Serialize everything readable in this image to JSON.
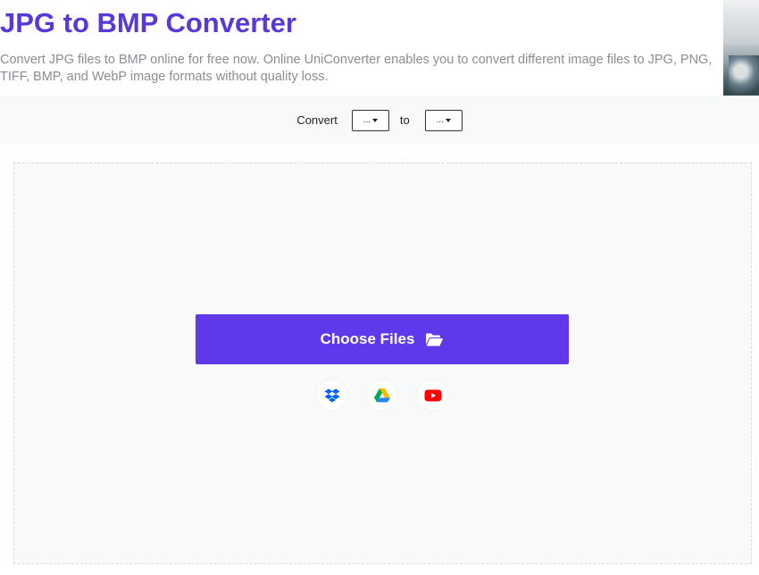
{
  "header": {
    "title": "JPG to BMP Converter",
    "description": "Convert JPG files to BMP online for free now. Online UniConverter enables you to convert different image files to JPG, PNG, TIFF, BMP, and WebP image formats without quality loss."
  },
  "convert_bar": {
    "convert_label": "Convert",
    "to_label": "to",
    "from_value": "...",
    "to_value": "..."
  },
  "upload": {
    "choose_files_label": "Choose Files",
    "sources": [
      "dropbox-icon",
      "google-drive-icon",
      "youtube-icon"
    ]
  },
  "colors": {
    "accent": "#5a37d8",
    "button": "#6038ec",
    "dropbox": "#0061fe",
    "youtube": "#ff0000"
  }
}
